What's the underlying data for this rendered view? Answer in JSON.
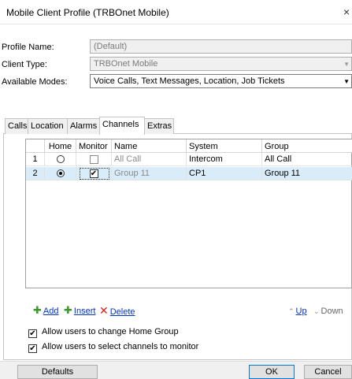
{
  "window": {
    "title": "Mobile Client Profile (TRBOnet Mobile)",
    "close_glyph": "×"
  },
  "form": {
    "profile_name_label": "Profile Name:",
    "profile_name_value": "(Default)",
    "client_type_label": "Client Type:",
    "client_type_value": "TRBOnet Mobile",
    "available_modes_label": "Available Modes:",
    "available_modes_value": "Voice Calls, Text Messages, Location, Job Tickets"
  },
  "tabs": [
    "Calls",
    "Location",
    "Alarms",
    "Channels",
    "Extras"
  ],
  "active_tab": "Channels",
  "grid": {
    "columns": [
      "Home",
      "Monitor",
      "Name",
      "System",
      "Group"
    ],
    "rows": [
      {
        "num": "1",
        "home": false,
        "monitor": false,
        "name": "All Call",
        "system": "Intercom",
        "group": "All Call"
      },
      {
        "num": "2",
        "home": true,
        "monitor": true,
        "name": "Group 11",
        "system": "CP1",
        "group": "Group 11",
        "selected": true
      }
    ]
  },
  "actions": {
    "add": "Add",
    "insert": "Insert",
    "delete": "Delete",
    "up": "Up",
    "down": "Down"
  },
  "options": [
    {
      "label": "Allow users to change Home Group",
      "checked": true
    },
    {
      "label": "Allow users to select channels to monitor",
      "checked": true
    }
  ],
  "buttons": {
    "defaults": "Defaults",
    "ok": "OK",
    "cancel": "Cancel"
  },
  "colors": {
    "selected_row": "#d9ecfa",
    "link": "#0033cc",
    "add_icon": "#3a9a2a",
    "delete_icon": "#e02020"
  }
}
